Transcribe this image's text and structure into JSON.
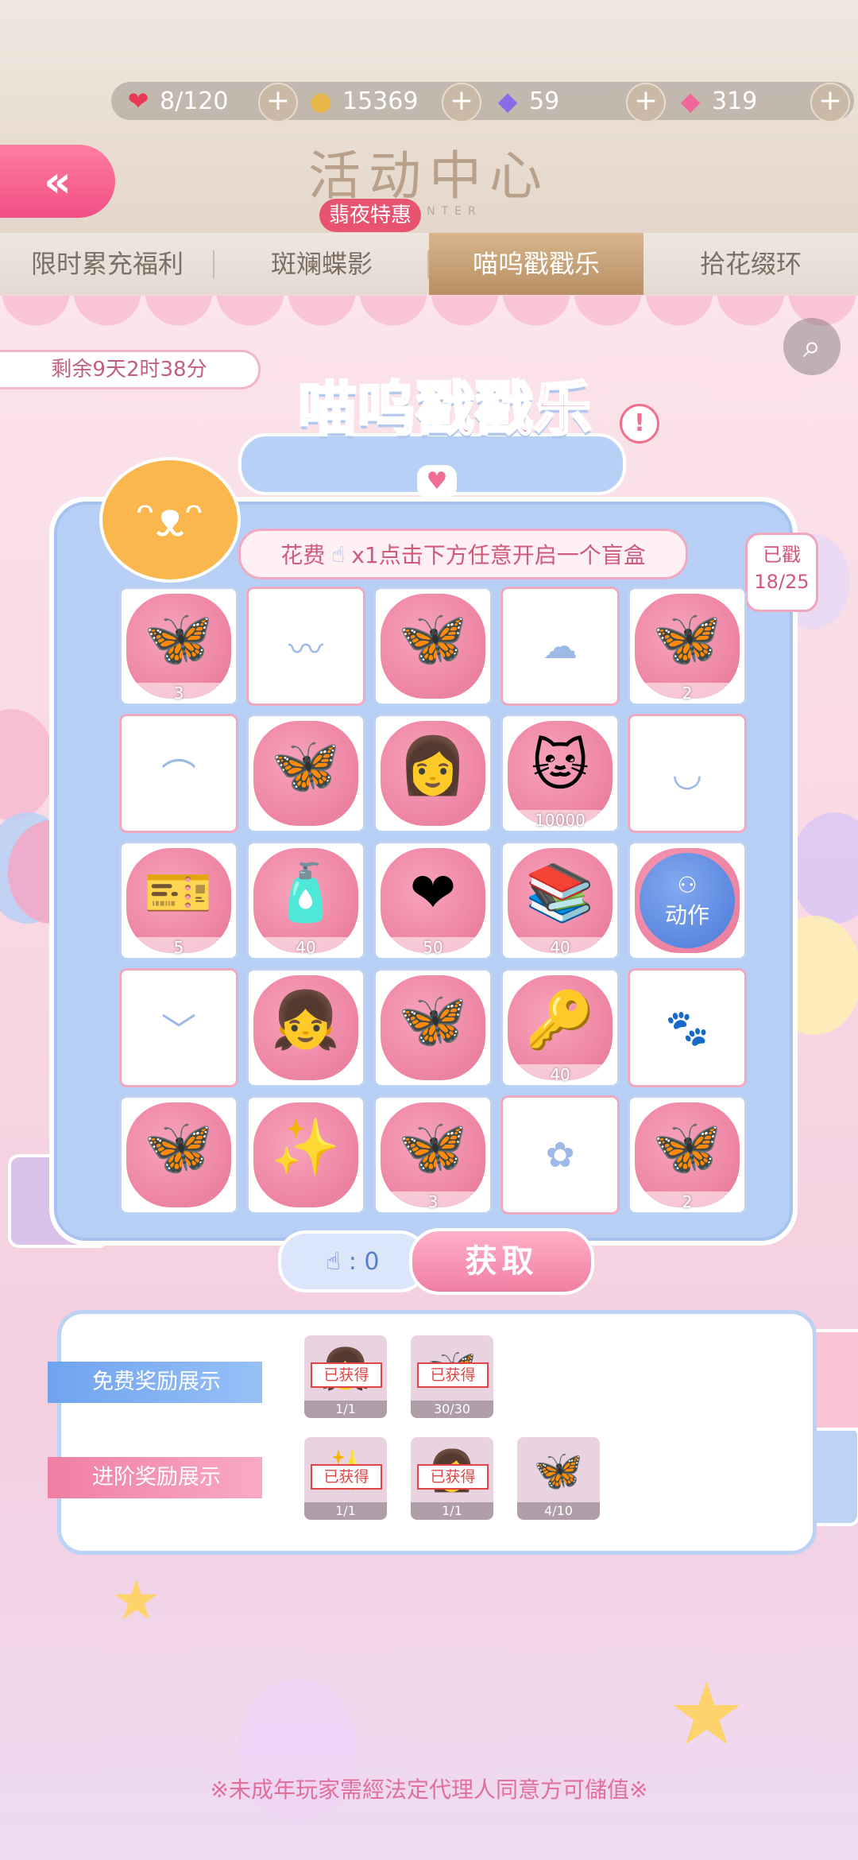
{
  "header": {
    "title": "活动中心",
    "subtitle": "E    CENTER",
    "promo_badge": "翡夜特惠",
    "currencies": [
      {
        "icon": "heart-icon",
        "value": "8/120",
        "color": "#e83a54"
      },
      {
        "icon": "cat-coin-icon",
        "value": "15369",
        "color": "#e8b84a"
      },
      {
        "icon": "diamond-icon",
        "value": "59",
        "color": "#8a6ae6"
      },
      {
        "icon": "pink-diamond-icon",
        "value": "319",
        "color": "#f0689a"
      }
    ],
    "plus_label": "+",
    "back_label": "«"
  },
  "tabs": [
    {
      "label": "限时累充福利",
      "active": false
    },
    {
      "label": "斑斓蝶影",
      "active": false
    },
    {
      "label": "喵呜戳戳乐",
      "active": true
    },
    {
      "label": "拾花缀环",
      "active": false
    }
  ],
  "event": {
    "timer": "剩余9天2时38分",
    "title": "喵呜戳戳乐",
    "info_label": "!",
    "cost_prefix": "花费",
    "cost_suffix": "x1点击下方任意开启一个盲盒",
    "cost_icon": "bunny-hand-icon",
    "progress_tag_line1": "已戳",
    "progress_tag_line2": "18/25"
  },
  "grid": [
    {
      "state": "revealed",
      "item": "butterfly-hairpin",
      "glyph": "🦋",
      "qty": "3"
    },
    {
      "state": "hidden",
      "glyph": "〰"
    },
    {
      "state": "revealed",
      "item": "butterfly-hairpin",
      "glyph": "🦋",
      "qty": ""
    },
    {
      "state": "hidden",
      "glyph": "☁"
    },
    {
      "state": "revealed",
      "item": "butterfly-hairpin",
      "glyph": "🦋",
      "qty": "2"
    },
    {
      "state": "hidden",
      "glyph": "⌒"
    },
    {
      "state": "revealed",
      "item": "butterfly-hairpin",
      "glyph": "🦋",
      "qty": ""
    },
    {
      "state": "revealed",
      "item": "pink-hair-avatar",
      "glyph": "👩",
      "qty": ""
    },
    {
      "state": "revealed",
      "item": "cat-coin",
      "glyph": "🐱",
      "qty": "10000"
    },
    {
      "state": "hidden",
      "glyph": "◡"
    },
    {
      "state": "revealed",
      "item": "gold-ticket",
      "glyph": "🎫",
      "qty": "5"
    },
    {
      "state": "revealed",
      "item": "perfume-books",
      "glyph": "🧴",
      "qty": "40"
    },
    {
      "state": "revealed",
      "item": "red-heart",
      "glyph": "❤",
      "qty": "50"
    },
    {
      "state": "revealed",
      "item": "fabric-stack",
      "glyph": "📚",
      "qty": "40"
    },
    {
      "state": "revealed",
      "item": "action",
      "glyph": "",
      "qty": "",
      "badge": "动作"
    },
    {
      "state": "hidden",
      "glyph": "﹀"
    },
    {
      "state": "revealed",
      "item": "pink-hair-outfit",
      "glyph": "👧",
      "qty": ""
    },
    {
      "state": "revealed",
      "item": "butterfly-hairpin",
      "glyph": "🦋",
      "qty": ""
    },
    {
      "state": "revealed",
      "item": "golden-key",
      "glyph": "🔑",
      "qty": "40"
    },
    {
      "state": "hidden",
      "glyph": "🐾"
    },
    {
      "state": "revealed",
      "item": "butterfly-hairpin",
      "glyph": "🦋",
      "qty": ""
    },
    {
      "state": "revealed",
      "item": "starry-orb",
      "glyph": "✨",
      "qty": ""
    },
    {
      "state": "revealed",
      "item": "butterfly-hairpin",
      "glyph": "🦋",
      "qty": "3"
    },
    {
      "state": "hidden",
      "glyph": "✿"
    },
    {
      "state": "revealed",
      "item": "butterfly-hairpin",
      "glyph": "🦋",
      "qty": "2"
    }
  ],
  "obtain": {
    "counter": ": 0",
    "button_label": "获取"
  },
  "rewards": {
    "free_label": "免费奖励展示",
    "advanced_label": "进阶奖励展示",
    "owned_label": "已获得",
    "free_items": [
      {
        "glyph": "👧",
        "owned": true,
        "progress": "1/1"
      },
      {
        "glyph": "🦋",
        "owned": true,
        "progress": "30/30"
      }
    ],
    "advanced_items": [
      {
        "glyph": "✨",
        "owned": true,
        "progress": "1/1"
      },
      {
        "glyph": "👩",
        "owned": true,
        "progress": "1/1"
      },
      {
        "glyph": "🦋",
        "owned": false,
        "progress": "4/10"
      }
    ]
  },
  "footer_note": "※未成年玩家需經法定代理人同意方可儲值※"
}
